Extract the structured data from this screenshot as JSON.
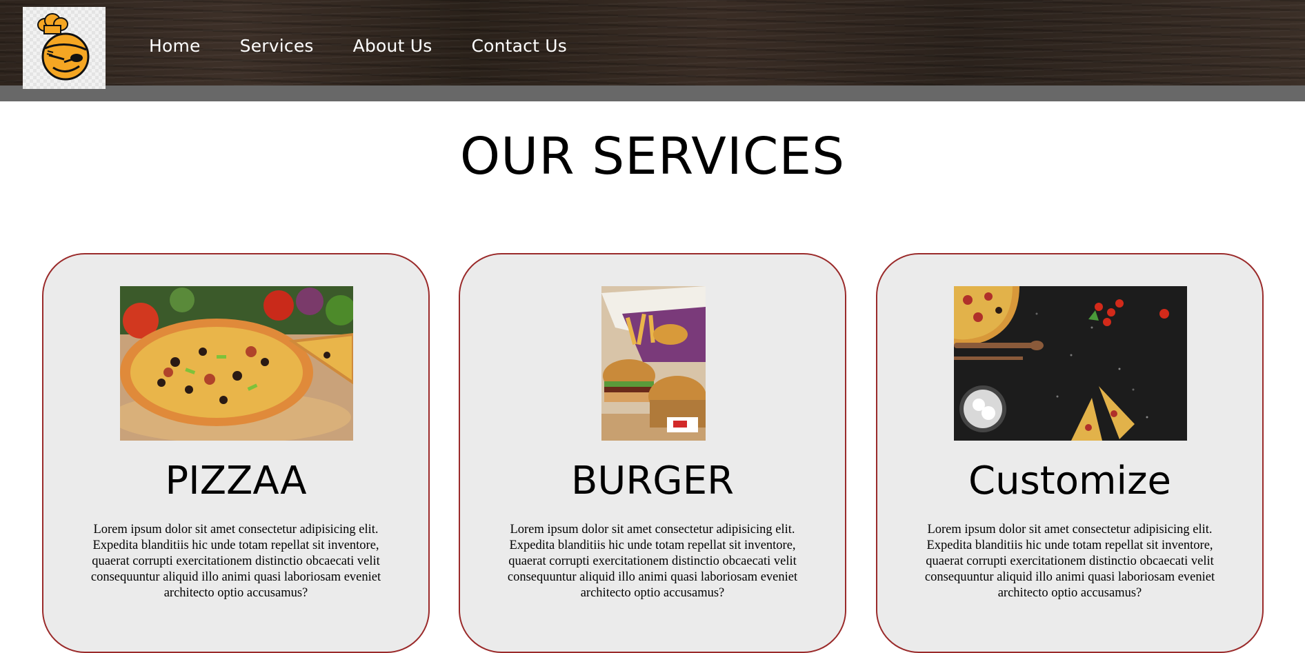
{
  "header": {
    "logo": {
      "icon": "chef-hat-logo-icon",
      "accent": "#f5a623"
    },
    "nav": [
      {
        "label": "Home"
      },
      {
        "label": "Services"
      },
      {
        "label": "About Us"
      },
      {
        "label": "Contact Us"
      }
    ]
  },
  "main": {
    "title": "OUR SERVICES",
    "cards": [
      {
        "title": "PIZZAA",
        "image": "pizza-image",
        "text": "Lorem ipsum dolor sit amet consectetur adipisicing elit. Expedita blanditiis hic unde totam repellat sit inventore, quaerat corrupti exercitationem distinctio obcaecati velit consequuntur aliquid illo animi quasi laboriosam eveniet architecto optio accusamus?"
      },
      {
        "title": "BURGER",
        "image": "burger-image",
        "text": "Lorem ipsum dolor sit amet consectetur adipisicing elit. Expedita blanditiis hic unde totam repellat sit inventore, quaerat corrupti exercitationem distinctio obcaecati velit consequuntur aliquid illo animi quasi laboriosam eveniet architecto optio accusamus?"
      },
      {
        "title": "Customize",
        "image": "customize-pizza-image",
        "text": "Lorem ipsum dolor sit amet consectetur adipisicing elit. Expedita blanditiis hic unde totam repellat sit inventore, quaerat corrupti exercitationem distinctio obcaecati velit consequuntur aliquid illo animi quasi laboriosam eveniet architecto optio accusamus?"
      }
    ]
  },
  "colors": {
    "card_border": "#9a2a2a",
    "card_background": "#ebebeb",
    "header_strip": "#686868"
  }
}
